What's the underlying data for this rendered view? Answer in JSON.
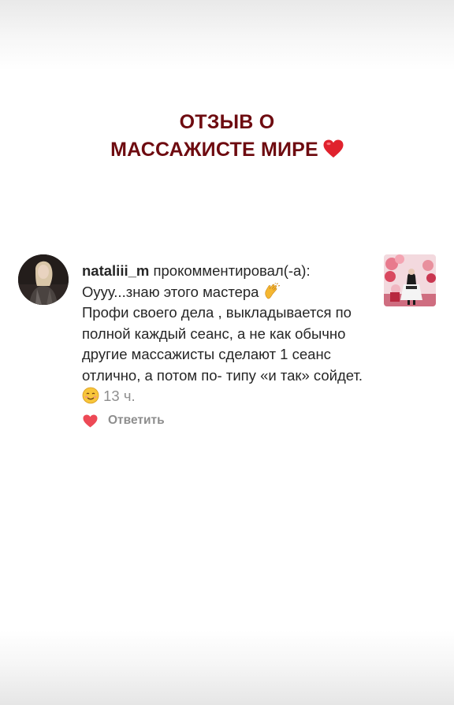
{
  "story": {
    "title_line1": "ОТЗЫВ О",
    "title_line2": "МАССАЖИСТЕ МИРЕ",
    "title_emoji": "heart-emoji",
    "title_color": "#6e0b10"
  },
  "comment": {
    "username": "nataliii_m",
    "action": "прокомментировал(-а):",
    "line1": "Оууу...знаю этого мастера",
    "body": "Профи своего дела , выкладывается по полной каждый сеанс, а не как обычно другие массажисты сделают 1 сеанс отлично,  а потом по- типу «и так» сойдет.",
    "time": "13 ч.",
    "emoji_1": "clapping-hands-emoji",
    "emoji_2": "smiling-face-emoji"
  },
  "actions": {
    "like_icon": "heart-icon",
    "like_color": "#ed4956",
    "reply_label": "Ответить"
  }
}
